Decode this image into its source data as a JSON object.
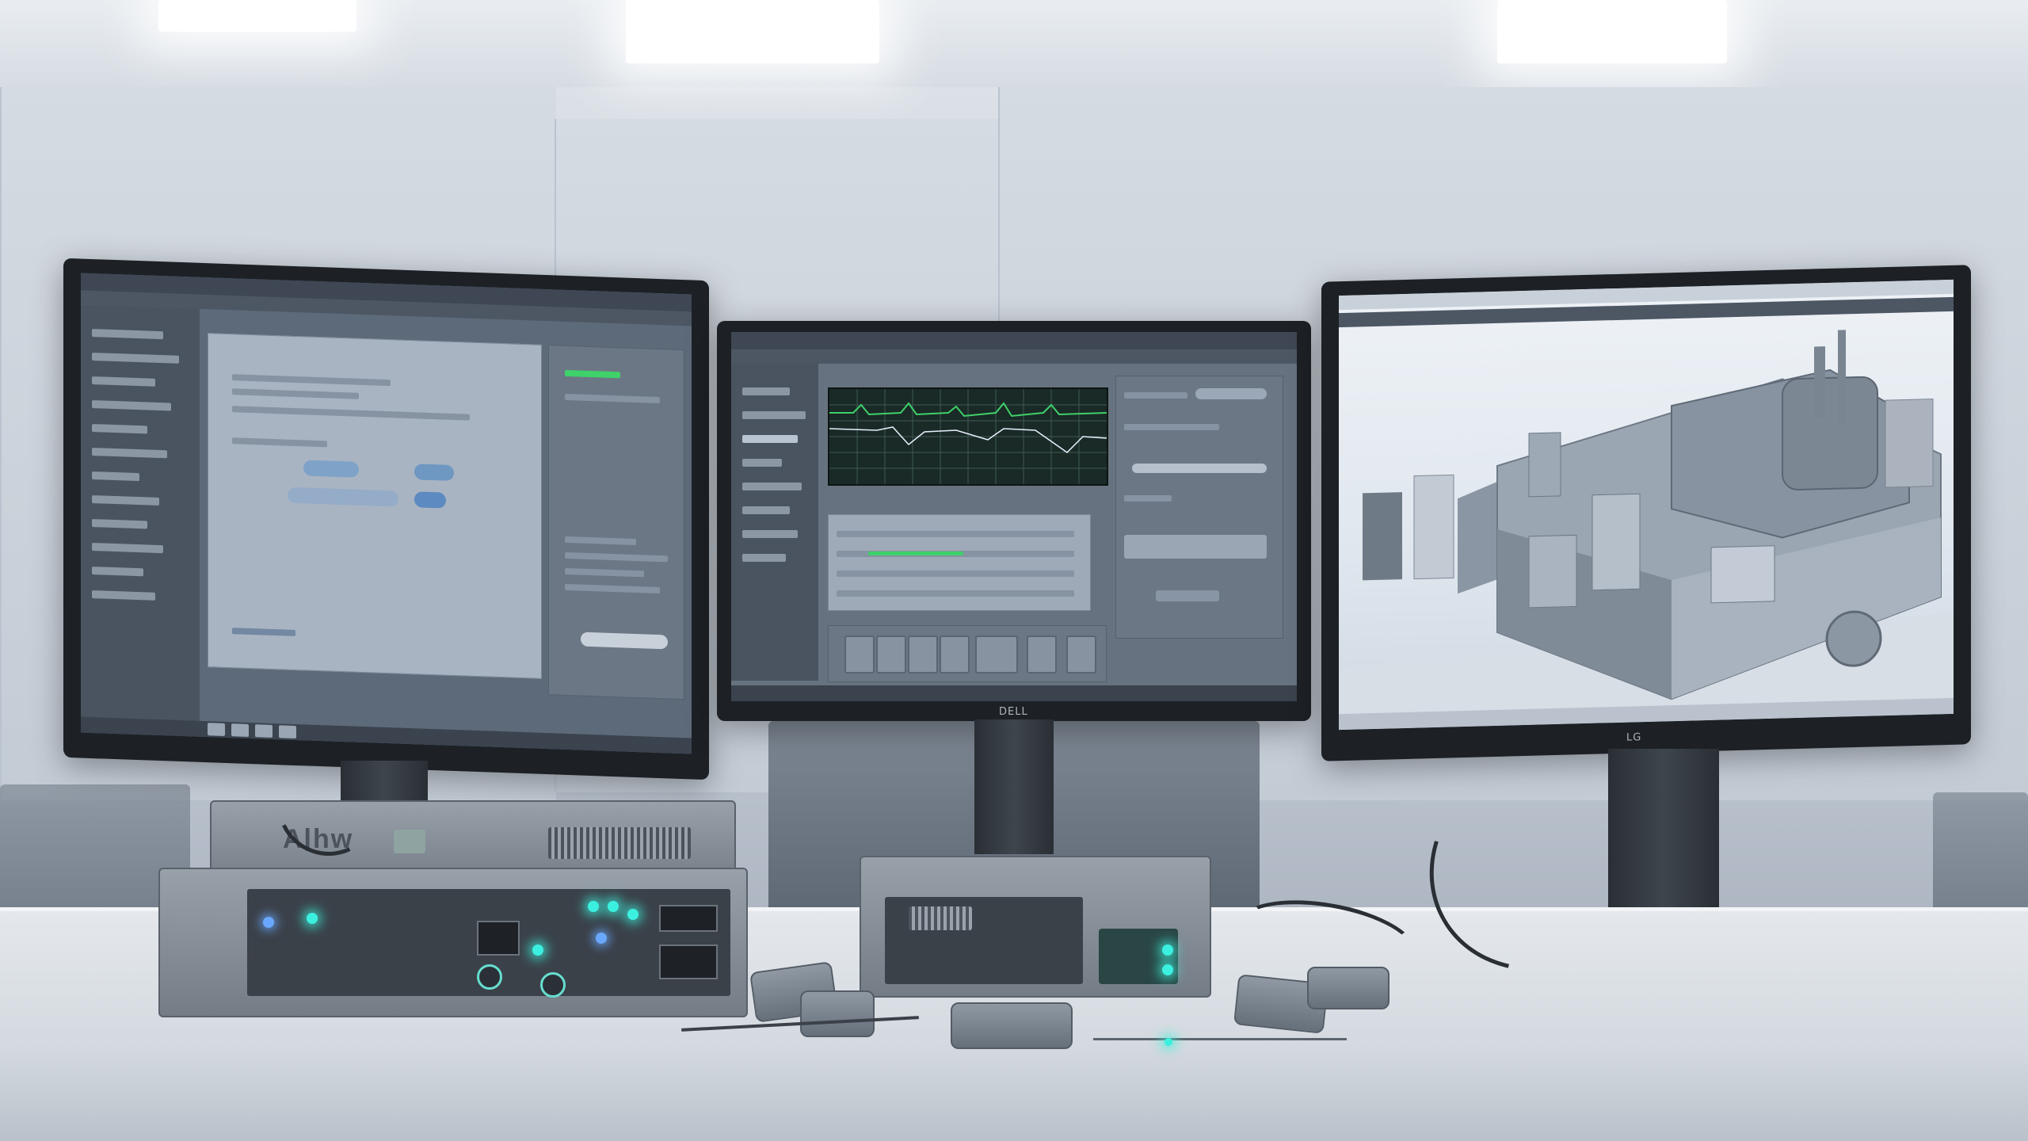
{
  "scene": {
    "description_tags": [
      "lab-room",
      "three-monitors",
      "hardware-rack",
      "desk"
    ]
  },
  "hardware": {
    "left_unit_brand": "Alhw"
  },
  "monitors": {
    "center_bezel_logo": "DELL",
    "right_bezel_logo": "LG"
  },
  "colors": {
    "led_cyan": "#3cf0e0",
    "led_blue": "#6aa8ff",
    "trace_green": "#3fd16a",
    "trace_white": "#e8f0ff"
  }
}
